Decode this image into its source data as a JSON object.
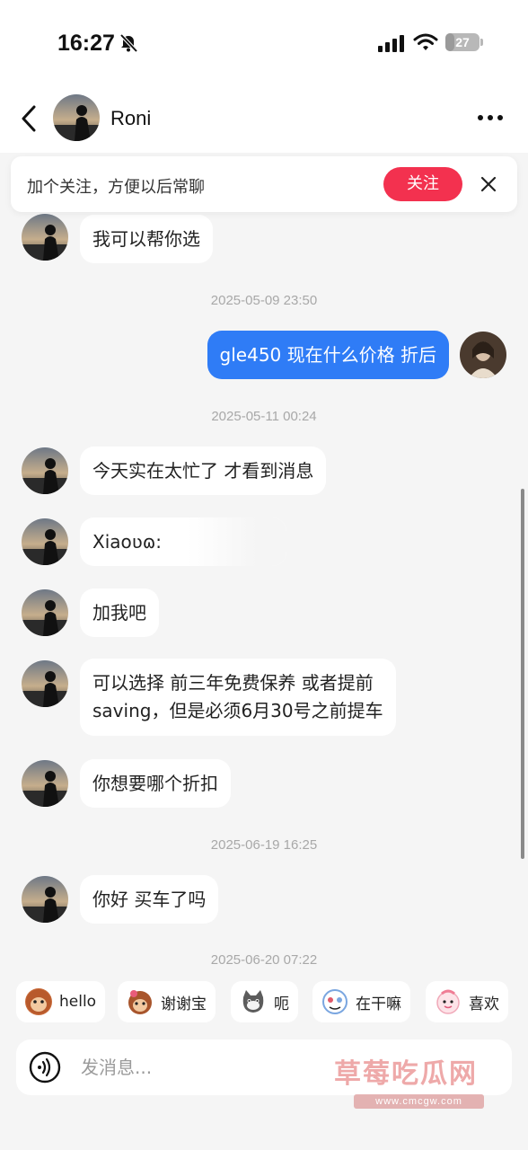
{
  "status_bar": {
    "time": "16:27",
    "battery": "27",
    "battery_level": 0.27
  },
  "header": {
    "contact_name": "Roni"
  },
  "follow_banner": {
    "text": "加个关注，方便以后常聊",
    "button_label": "关注"
  },
  "messages": [
    {
      "side": "received",
      "text": "我可以帮你选"
    },
    {
      "timestamp": "2025-05-09 23:50"
    },
    {
      "side": "sent",
      "text": "gle450 现在什么价格 折后"
    },
    {
      "timestamp": "2025-05-11 00:24"
    },
    {
      "side": "received",
      "text": "今天实在太忙了 才看到消息"
    },
    {
      "side": "received",
      "text": "Xiaoʋɷ:"
    },
    {
      "side": "received",
      "text": "加我吧"
    },
    {
      "side": "received",
      "lines": [
        "可以选择 前三年免费保养 或者提前",
        "saving，但是必须6月30号之前提车"
      ]
    },
    {
      "side": "received",
      "text": "你想要哪个折扣"
    },
    {
      "timestamp": "2025-06-19 16:25"
    },
    {
      "side": "received",
      "text": "你好 买车了吗"
    },
    {
      "timestamp": "2025-06-20 07:22"
    }
  ],
  "quick_replies": [
    {
      "label": "hello",
      "icon": "monkey-icon",
      "color": "#c96b3a"
    },
    {
      "label": "谢谢宝",
      "icon": "monkey-flower-icon",
      "color": "#b8643a"
    },
    {
      "label": "呃",
      "icon": "cat-icon",
      "color": "#6c6c6c"
    },
    {
      "label": "在干嘛",
      "icon": "cartoon-face-icon",
      "color": "#7aa6e0"
    },
    {
      "label": "喜欢",
      "icon": "pink-face-icon",
      "color": "#f0a8b8"
    }
  ],
  "input": {
    "placeholder": "发消息..."
  },
  "watermark": {
    "text": "草莓吃瓜网",
    "sub": "www.cmcgw.com"
  },
  "colors": {
    "accent_red": "#f3314f",
    "sent_bubble": "#2f7cf6",
    "background": "#f5f5f5"
  }
}
